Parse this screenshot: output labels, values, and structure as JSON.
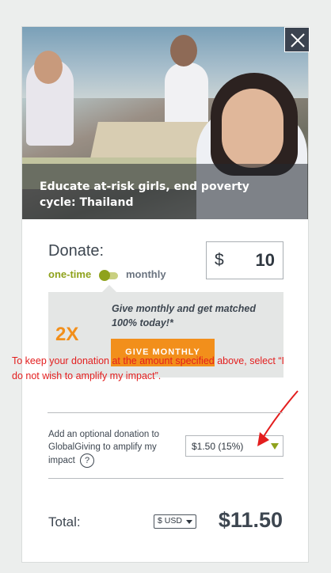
{
  "hero": {
    "caption": "Educate at-risk girls, end poverty cycle: Thailand"
  },
  "donate": {
    "label": "Donate:",
    "frequency": {
      "one_time_label": "one-time",
      "monthly_label": "monthly",
      "selected": "one-time"
    },
    "amount": {
      "currency_symbol": "$",
      "value": "10"
    }
  },
  "promo": {
    "multiplier": "2X",
    "message": "Give monthly and get matched 100% today!*",
    "button_label": "GIVE MONTHLY"
  },
  "annotation": {
    "note": "To keep your donation at the amount specified above, select “I do not wish to amplify my impact”."
  },
  "addon": {
    "label": "Add an optional donation to GlobalGiving to amplify my impact",
    "help_icon_text": "?",
    "selected_option": "$1.50 (15%)"
  },
  "total": {
    "label": "Total:",
    "currency": "$ USD",
    "value": "$11.50"
  },
  "colors": {
    "accent_orange": "#f28f1b",
    "accent_green": "#8fa21c",
    "annotation_red": "#e31e1e",
    "text_dark": "#3d4650"
  },
  "icons": {
    "close": "close-icon",
    "help": "help-icon",
    "dropdown": "chevron-down-icon"
  }
}
